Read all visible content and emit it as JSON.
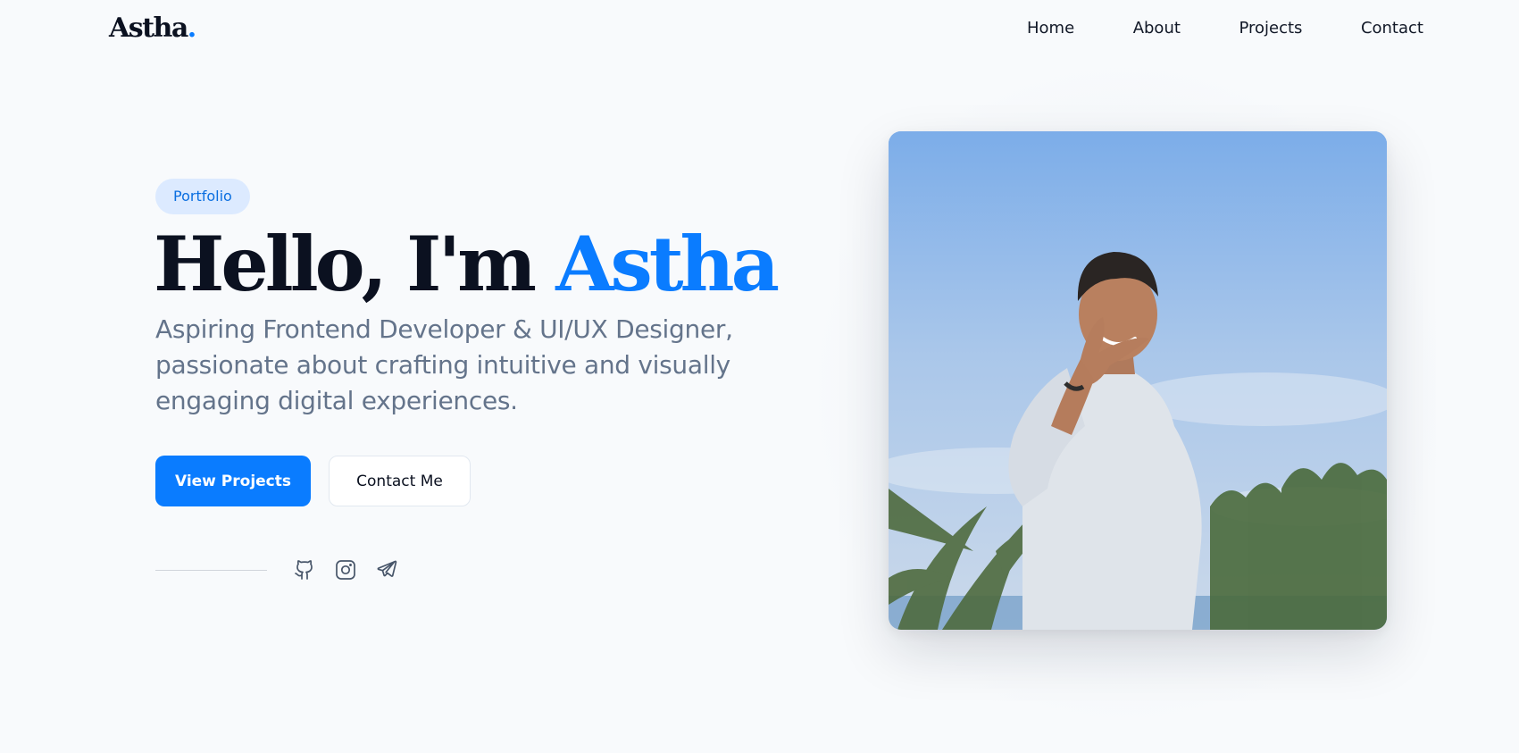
{
  "header": {
    "brand_name": "Astha",
    "brand_dot": ".",
    "nav": [
      "Home",
      "About",
      "Projects",
      "Contact"
    ]
  },
  "hero": {
    "badge": "Portfolio",
    "headline_prefix": "Hello, I'm ",
    "headline_accent": "Astha",
    "subtitle": "Aspiring Frontend Developer & UI/UX Designer, passionate about crafting intuitive and visually engaging digital experiences.",
    "primary_button": "View Projects",
    "secondary_button": "Contact Me",
    "socials": [
      "github-icon",
      "instagram-icon",
      "telegram-icon"
    ]
  },
  "colors": {
    "accent": "#0a7cff",
    "text": "#0b1120",
    "muted": "#64748b",
    "background": "#f8fafc",
    "badge_bg": "#dceaff"
  }
}
